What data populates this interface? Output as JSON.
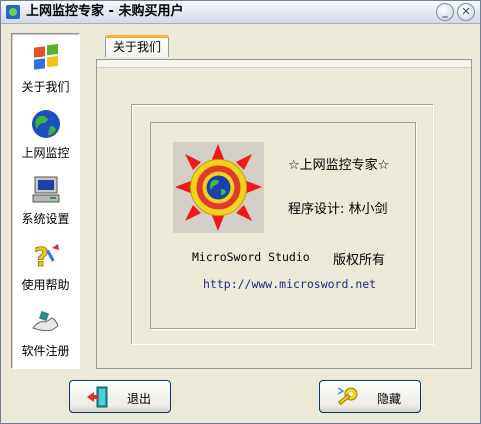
{
  "window": {
    "title": "上网监控专家 - 未购买用户",
    "minimize_glyph": "_",
    "close_glyph": "✕"
  },
  "sidebar": {
    "items": [
      {
        "label": "关于我们",
        "icon": "about-windows-flag-icon"
      },
      {
        "label": "上网监控",
        "icon": "globe-icon"
      },
      {
        "label": "系统设置",
        "icon": "computer-icon"
      },
      {
        "label": "使用帮助",
        "icon": "help-question-icon"
      },
      {
        "label": "软件注册",
        "icon": "register-hands-icon"
      }
    ]
  },
  "tabs": [
    {
      "label": "关于我们",
      "active": true
    }
  ],
  "about": {
    "product_name": "☆上网监控专家☆",
    "author": "程序设计: 林小剑",
    "studio": "MicroSword Studio",
    "rights": "版权所有",
    "url": "http://www.microsword.net",
    "logo_icon": "sun-globe-logo-icon"
  },
  "buttons": {
    "exit_label": "退出",
    "exit_icon": "exit-door-icon",
    "hide_label": "隐藏",
    "hide_icon": "key-icon"
  },
  "colors": {
    "window_bg": "#ece9d8",
    "tab_highlight": "#f0b432",
    "url_color": "#1c2a8c"
  }
}
